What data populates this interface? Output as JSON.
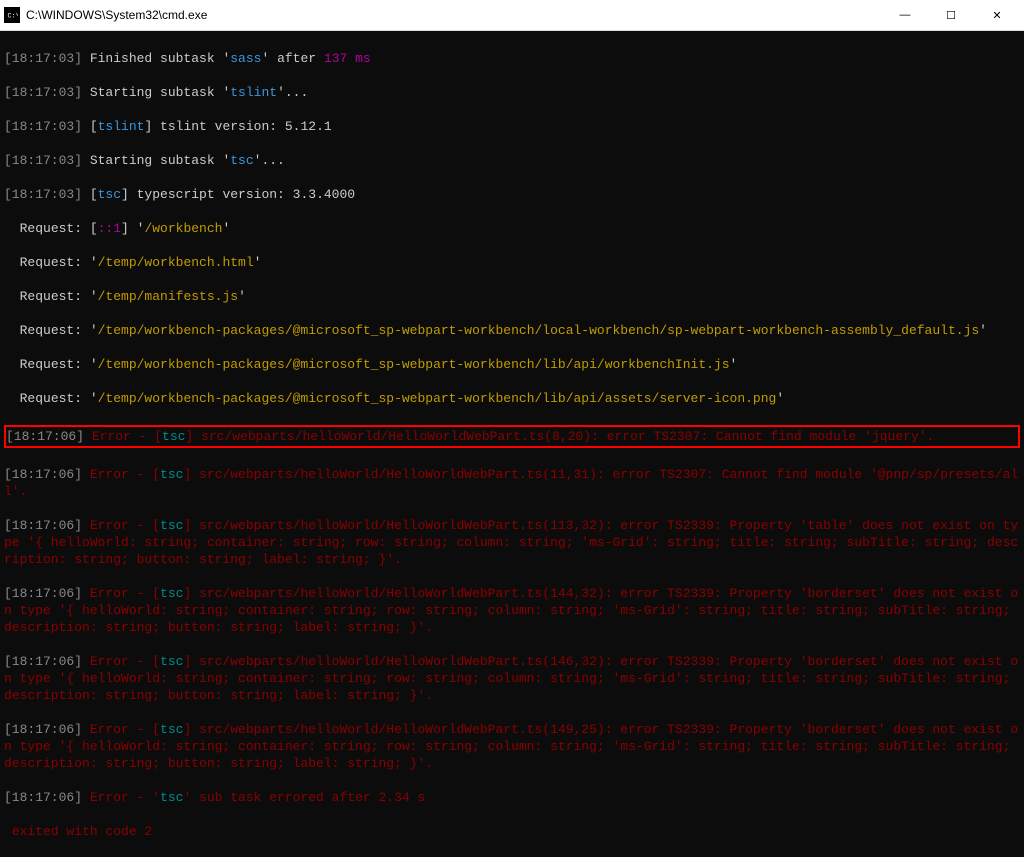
{
  "window": {
    "title": "C:\\WINDOWS\\System32\\cmd.exe",
    "min_icon": "—",
    "max_icon": "☐",
    "close_icon": "✕"
  },
  "log": {
    "l1_ts": "[18:17:03]",
    "l1_a": " Finished subtask '",
    "l1_b": "sass",
    "l1_c": "' after ",
    "l1_d": "137 ms",
    "l2_ts": "[18:17:03]",
    "l2_a": " Starting subtask '",
    "l2_b": "tslint",
    "l2_c": "'...",
    "l3_ts": "[18:17:03]",
    "l3_a": " [",
    "l3_b": "tslint",
    "l3_c": "] tslint version: 5.12.1",
    "l4_ts": "[18:17:03]",
    "l4_a": " Starting subtask '",
    "l4_b": "tsc",
    "l4_c": "'...",
    "l5_ts": "[18:17:03]",
    "l5_a": " [",
    "l5_b": "tsc",
    "l5_c": "] typescript version: 3.3.4000",
    "l6_a": "  Request: [",
    "l6_b": "::1",
    "l6_c": "] '",
    "l6_d": "/workbench",
    "l6_e": "'",
    "l7_a": "  Request: '",
    "l7_b": "/temp/workbench.html",
    "l7_c": "'",
    "l8_a": "  Request: '",
    "l8_b": "/temp/manifests.js",
    "l8_c": "'",
    "l9_a": "  Request: '",
    "l9_b": "/temp/workbench-packages/@microsoft_sp-webpart-workbench/local-workbench/sp-webpart-workbench-assembly_default.js",
    "l9_c": "'",
    "l10_a": "  Request: '",
    "l10_b": "/temp/workbench-packages/@microsoft_sp-webpart-workbench/lib/api/workbenchInit.js",
    "l10_c": "'",
    "l11_a": "  Request: '",
    "l11_b": "/temp/workbench-packages/@microsoft_sp-webpart-workbench/lib/api/assets/server-icon.png",
    "l11_c": "'",
    "e1_ts": "[18:17:06]",
    "e1_a": " Error - [",
    "e1_b": "tsc",
    "e1_c": "] src/webparts/helloWorld/HelloWorldWebPart.ts(8,20): error TS2307: Cannot find module 'jquery'.",
    "e2_ts": "[18:17:06]",
    "e2_a": " Error - [",
    "e2_b": "tsc",
    "e2_c": "] src/webparts/helloWorld/HelloWorldWebPart.ts(11,31): error TS2307: Cannot find module '@pnp/sp/presets/all'.",
    "e3_ts": "[18:17:06]",
    "e3_a": " Error - [",
    "e3_b": "tsc",
    "e3_c": "] src/webparts/helloWorld/HelloWorldWebPart.ts(113,32): error TS2339: Property 'table' does not exist on type '{ helloWorld: string; container: string; row: string; column: string; 'ms-Grid': string; title: string; subTitle: string; description: string; button: string; label: string; }'.",
    "e4_ts": "[18:17:06]",
    "e4_a": " Error - [",
    "e4_b": "tsc",
    "e4_c": "] src/webparts/helloWorld/HelloWorldWebPart.ts(144,32): error TS2339: Property 'borderset' does not exist on type '{ helloWorld: string; container: string; row: string; column: string; 'ms-Grid': string; title: string; subTitle: string; description: string; button: string; label: string; }'.",
    "e5_ts": "[18:17:06]",
    "e5_a": " Error - [",
    "e5_b": "tsc",
    "e5_c": "] src/webparts/helloWorld/HelloWorldWebPart.ts(146,32): error TS2339: Property 'borderset' does not exist on type '{ helloWorld: string; container: string; row: string; column: string; 'ms-Grid': string; title: string; subTitle: string; description: string; button: string; label: string; }'.",
    "e6_ts": "[18:17:06]",
    "e6_a": " Error - [",
    "e6_b": "tsc",
    "e6_c": "] src/webparts/helloWorld/HelloWorldWebPart.ts(149,25): error TS2339: Property 'borderset' does not exist on type '{ helloWorld: string; container: string; row: string; column: string; 'ms-Grid': string; title: string; subTitle: string; description: string; button: string; label: string; }'.",
    "f1_ts": "[18:17:06]",
    "f1_a": " Error - '",
    "f1_b": "tsc",
    "f1_c": "' sub task errored after 2.34 s",
    "f2": " exited with code 2"
  }
}
